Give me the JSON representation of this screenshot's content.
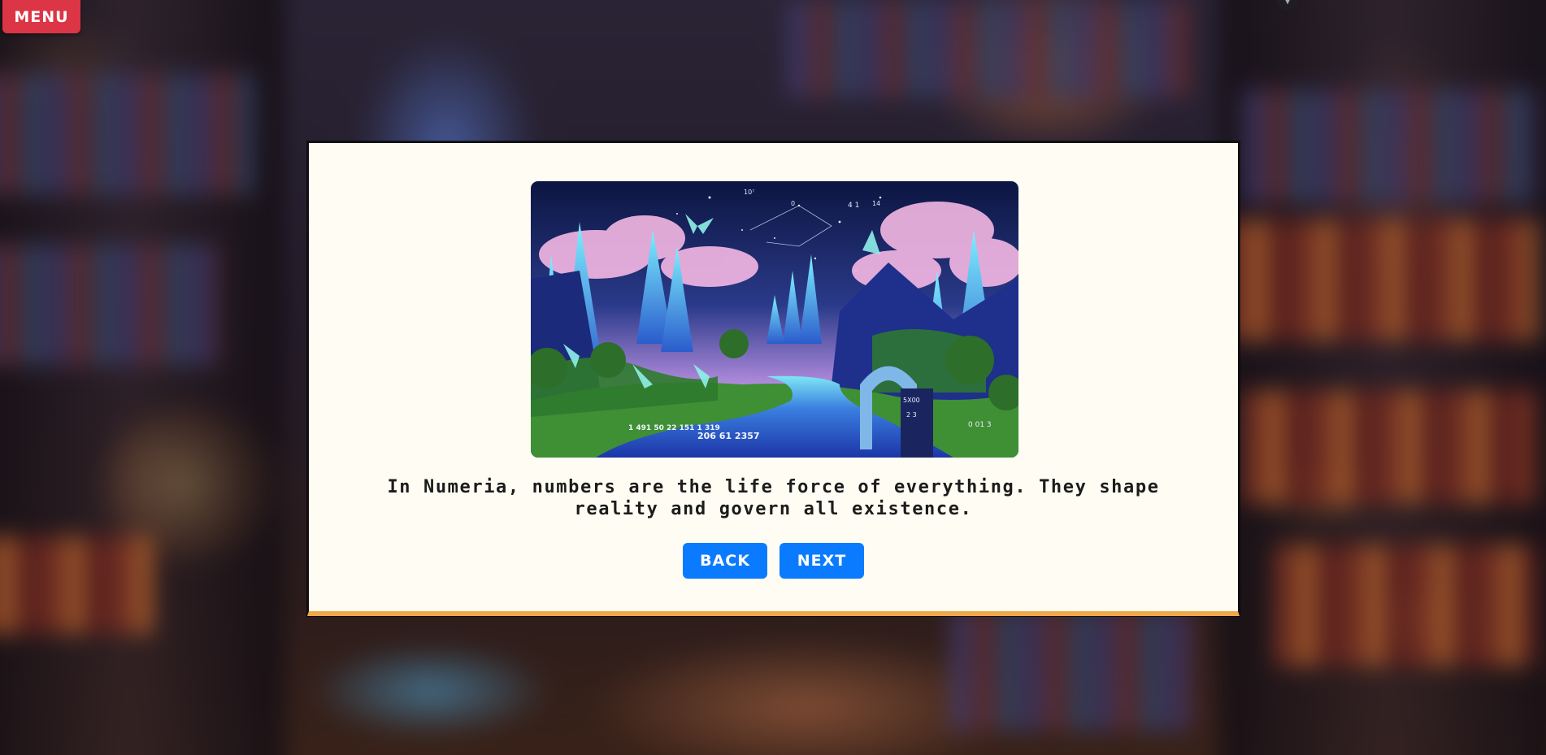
{
  "menu": {
    "label": "MENU",
    "color": "#dc3545"
  },
  "dialog": {
    "story_text": "In Numeria, numbers are the life force of everything. They shape reality and govern all existence.",
    "image_numbers": [
      "10⁷",
      "0",
      "4 1",
      "14",
      "206 61 2357",
      "1 491 50 22 151 1 319",
      "5X00",
      "2 3",
      "0 01 3"
    ],
    "back_label": "BACK",
    "next_label": "NEXT",
    "button_color": "#0a7bff",
    "accent_color": "#f0a94a",
    "background_color": "#fffdf3"
  }
}
